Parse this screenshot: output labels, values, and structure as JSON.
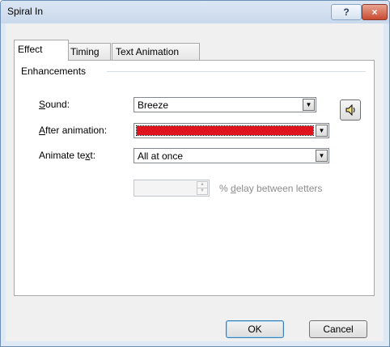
{
  "window": {
    "title": "Spiral In"
  },
  "titlebar": {
    "help_label": "?",
    "close_label": "×"
  },
  "tabs": [
    {
      "label": "Effect",
      "active": true
    },
    {
      "label": "Timing",
      "active": false
    },
    {
      "label": "Text Animation",
      "active": false
    }
  ],
  "enhancements": {
    "group_label": "Enhancements",
    "sound": {
      "label_accel": "S",
      "label_rest": "ound:",
      "value": "Breeze"
    },
    "after_animation": {
      "label_accel": "A",
      "label_rest": "fter animation:",
      "color": "#e0141e"
    },
    "animate_text": {
      "label_pre": "Animate te",
      "label_accel": "x",
      "label_post": "t:",
      "value": "All at once"
    },
    "delay": {
      "value": "",
      "label_pre": "% ",
      "label_accel": "d",
      "label_post": "elay between letters",
      "enabled": false
    }
  },
  "icons": {
    "speaker": "speaker-icon",
    "dropdown": "dropdown-arrow-icon"
  },
  "buttons": {
    "ok": "OK",
    "cancel": "Cancel"
  }
}
